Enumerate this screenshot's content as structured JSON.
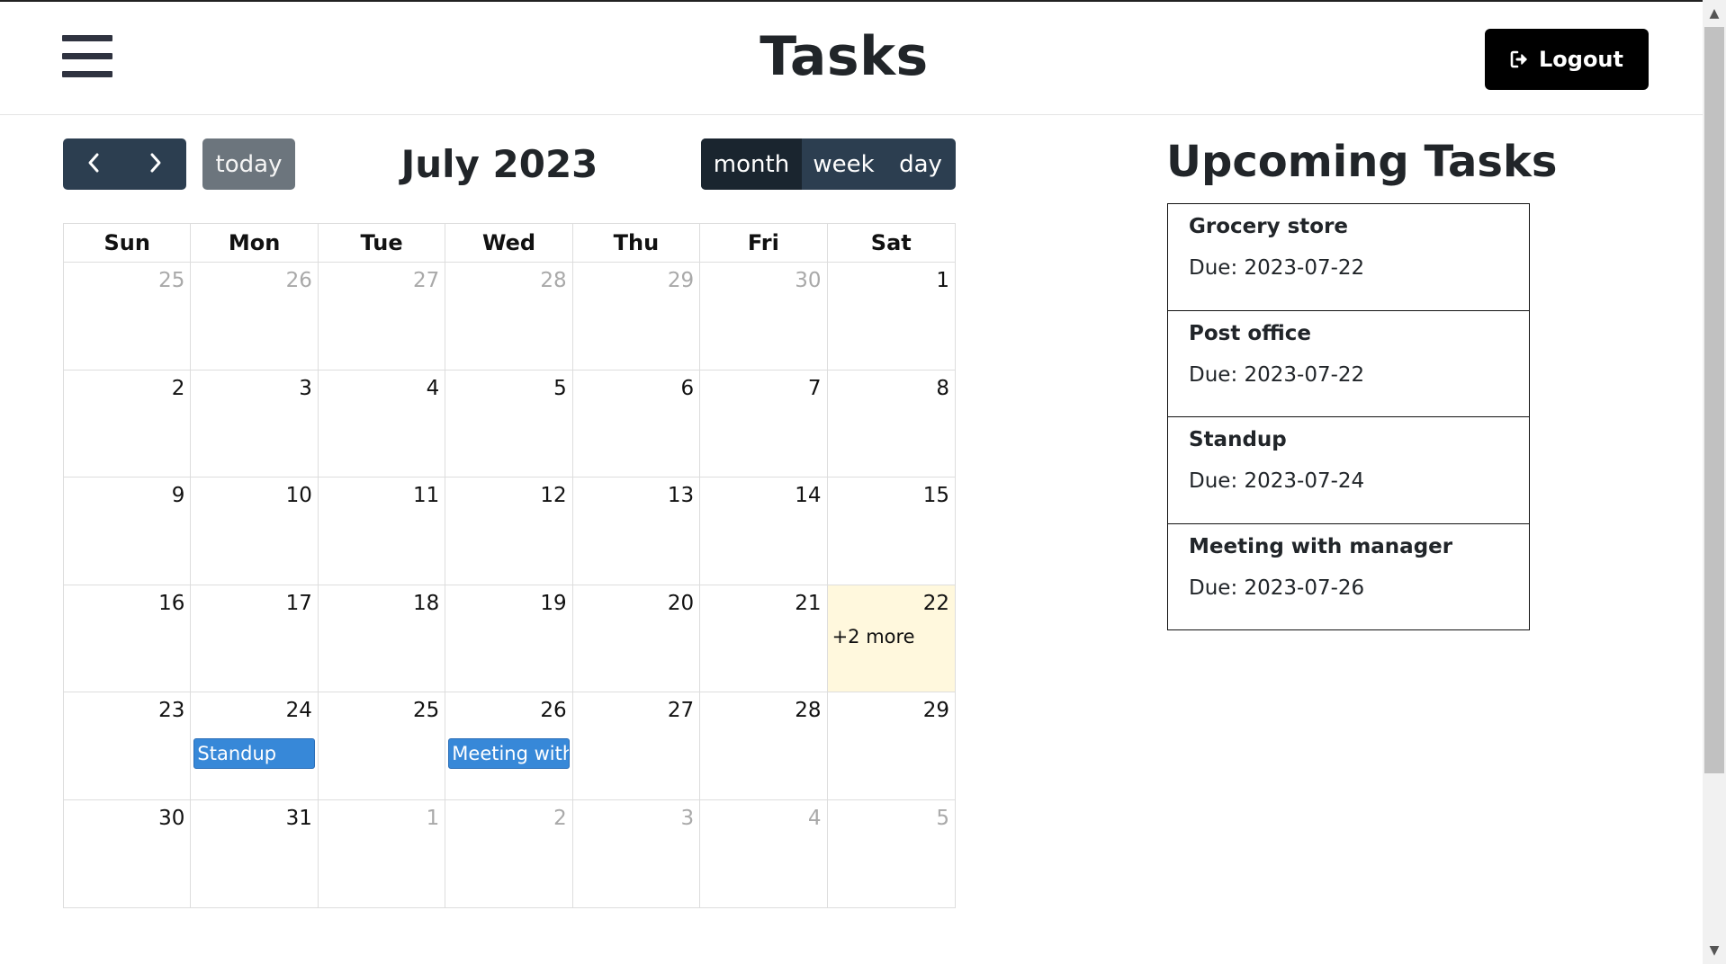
{
  "header": {
    "title": "Tasks",
    "logout_label": "Logout"
  },
  "calendar": {
    "title": "July 2023",
    "today_label": "today",
    "views": [
      {
        "label": "month",
        "active": true
      },
      {
        "label": "week",
        "active": false
      },
      {
        "label": "day",
        "active": false
      }
    ],
    "day_headers": [
      "Sun",
      "Mon",
      "Tue",
      "Wed",
      "Thu",
      "Fri",
      "Sat"
    ],
    "weeks": [
      [
        {
          "d": "25",
          "other": true
        },
        {
          "d": "26",
          "other": true
        },
        {
          "d": "27",
          "other": true
        },
        {
          "d": "28",
          "other": true
        },
        {
          "d": "29",
          "other": true
        },
        {
          "d": "30",
          "other": true
        },
        {
          "d": "1"
        }
      ],
      [
        {
          "d": "2"
        },
        {
          "d": "3"
        },
        {
          "d": "4"
        },
        {
          "d": "5"
        },
        {
          "d": "6"
        },
        {
          "d": "7"
        },
        {
          "d": "8"
        }
      ],
      [
        {
          "d": "9"
        },
        {
          "d": "10"
        },
        {
          "d": "11"
        },
        {
          "d": "12"
        },
        {
          "d": "13"
        },
        {
          "d": "14"
        },
        {
          "d": "15"
        }
      ],
      [
        {
          "d": "16"
        },
        {
          "d": "17"
        },
        {
          "d": "18"
        },
        {
          "d": "19"
        },
        {
          "d": "20"
        },
        {
          "d": "21"
        },
        {
          "d": "22",
          "today": true,
          "more": "+2 more"
        }
      ],
      [
        {
          "d": "23"
        },
        {
          "d": "24",
          "event": "Standup"
        },
        {
          "d": "25"
        },
        {
          "d": "26",
          "event": "Meeting with"
        },
        {
          "d": "27"
        },
        {
          "d": "28"
        },
        {
          "d": "29"
        }
      ],
      [
        {
          "d": "30"
        },
        {
          "d": "31"
        },
        {
          "d": "1",
          "other": true
        },
        {
          "d": "2",
          "other": true
        },
        {
          "d": "3",
          "other": true
        },
        {
          "d": "4",
          "other": true
        },
        {
          "d": "5",
          "other": true
        }
      ]
    ]
  },
  "upcoming": {
    "title": "Upcoming Tasks",
    "tasks": [
      {
        "name": "Grocery store",
        "due": "Due: 2023-07-22"
      },
      {
        "name": "Post office",
        "due": "Due: 2023-07-22"
      },
      {
        "name": "Standup",
        "due": "Due: 2023-07-24"
      },
      {
        "name": "Meeting with manager",
        "due": "Due: 2023-07-26"
      }
    ]
  },
  "colors": {
    "toolbar_button": "#2c3e50",
    "today_button": "#6c757d",
    "event": "#3788d8",
    "today_highlight": "#fff8dd",
    "logout_button": "#000000"
  },
  "icons": {
    "menu": "hamburger-icon",
    "logout": "sign-out-icon",
    "prev": "chevron-left-icon",
    "next": "chevron-right-icon"
  }
}
